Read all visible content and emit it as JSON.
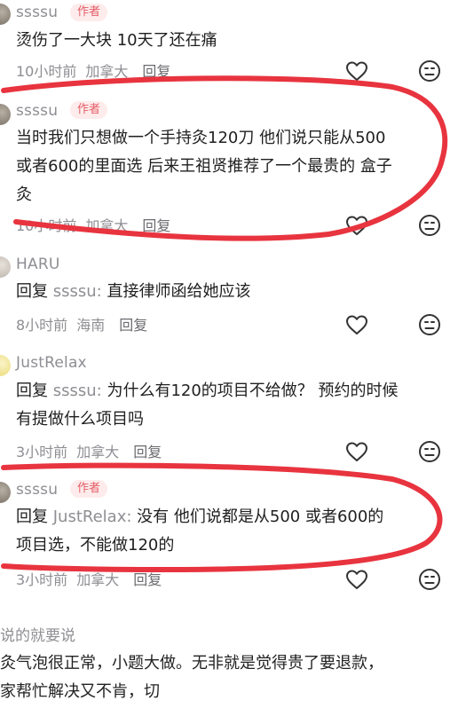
{
  "comments": [
    {
      "user": "ssssu",
      "badge": "作者",
      "text": "烫伤了一大块 10天了还在痛",
      "time": "10小时前",
      "location": "加拿大",
      "reply_label": "回复"
    },
    {
      "user": "ssssu",
      "badge": "作者",
      "text_line1": "当时我们只想做一个手持灸120刀 他们说只能从500",
      "text_line2": "或者600的里面选 后来王祖贤推荐了一个最贵的 盒子",
      "text_line3": "灸",
      "time": "10小时前",
      "location": "加拿大",
      "reply_label": "回复"
    },
    {
      "user": "HARU",
      "reply_prefix": "回复",
      "reply_to": "ssssu:",
      "text": "直接律师函给她应该",
      "time": "8小时前",
      "location": "海南",
      "reply_label": "回复"
    },
    {
      "user": "JustRelax",
      "reply_prefix": "回复",
      "reply_to": "ssssu:",
      "text_line1": "为什么有120的项目不给做？ 预约的时候",
      "text_line2": "有提做什么项目吗",
      "time": "3小时前",
      "location": "加拿大",
      "reply_label": "回复"
    },
    {
      "user": "ssssu",
      "badge": "作者",
      "reply_prefix": "回复",
      "reply_to": "JustRelax:",
      "text_line1": "没有 他们说都是从500 或者600的",
      "text_line2": "项目选，不能做120的",
      "time": "3小时前",
      "location": "加拿大",
      "reply_label": "回复"
    }
  ],
  "footer": {
    "user": "说的就要说",
    "text_line1": "灸气泡很正常，小题大做。无非就是觉得贵了要退款，",
    "text_line2": "家帮忙解决又不肯，切"
  },
  "colors": {
    "highlight": "#e8343f",
    "badge_text": "#e55b66",
    "badge_bg": "#fdeceb"
  },
  "icons": [
    "heart-icon",
    "emoji-face-icon"
  ]
}
